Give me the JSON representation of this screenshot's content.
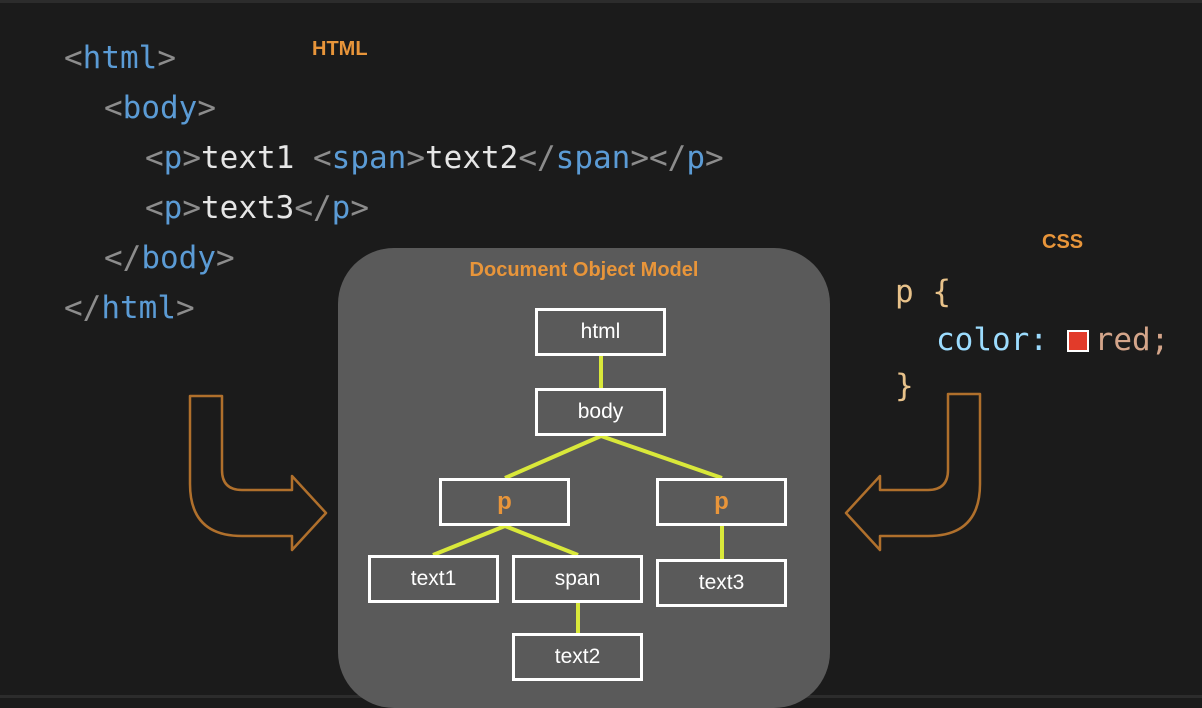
{
  "labels": {
    "html_label": "HTML",
    "css_label": "CSS",
    "dom_title": "Document Object Model"
  },
  "html_code": {
    "line1": {
      "open": "<",
      "tag": "html",
      "close": ">"
    },
    "line2": {
      "open": "<",
      "tag": "body",
      "close": ">"
    },
    "line3": {
      "p_open_lt": "<",
      "p_tag": "p",
      "p_open_gt": ">",
      "text1": "text1 ",
      "span_lt": "<",
      "span_tag": "span",
      "span_gt": ">",
      "text2": "text2",
      "span_close_lt": "</",
      "span_close_tag": "span",
      "span_close_gt": ">",
      "p_close_lt": "</",
      "p_close_tag": "p",
      "p_close_gt": ">"
    },
    "line4": {
      "p_open_lt": "<",
      "p_tag": "p",
      "p_open_gt": ">",
      "text3": "text3",
      "p_close_lt": "</",
      "p_close_tag": "p",
      "p_close_gt": ">"
    },
    "line5": {
      "open": "</",
      "tag": "body",
      "close": ">"
    },
    "line6": {
      "open": "</",
      "tag": "html",
      "close": ">"
    }
  },
  "css_code": {
    "selector": "p {",
    "property": "color:",
    "value": "red;",
    "closing": "}",
    "swatch_color": "#e23b2a"
  },
  "dom_nodes": {
    "html": "html",
    "body": "body",
    "p1": "p",
    "p2": "p",
    "text1": "text1",
    "span": "span",
    "text3": "text3",
    "text2": "text2"
  },
  "colors": {
    "background": "#1b1b1b",
    "panel": "#5a5a5a",
    "accent_orange": "#e8953a",
    "edge_yellow": "#d9e83a",
    "arrow_brown": "#b0702c",
    "tag_blue": "#5b9bd5"
  }
}
